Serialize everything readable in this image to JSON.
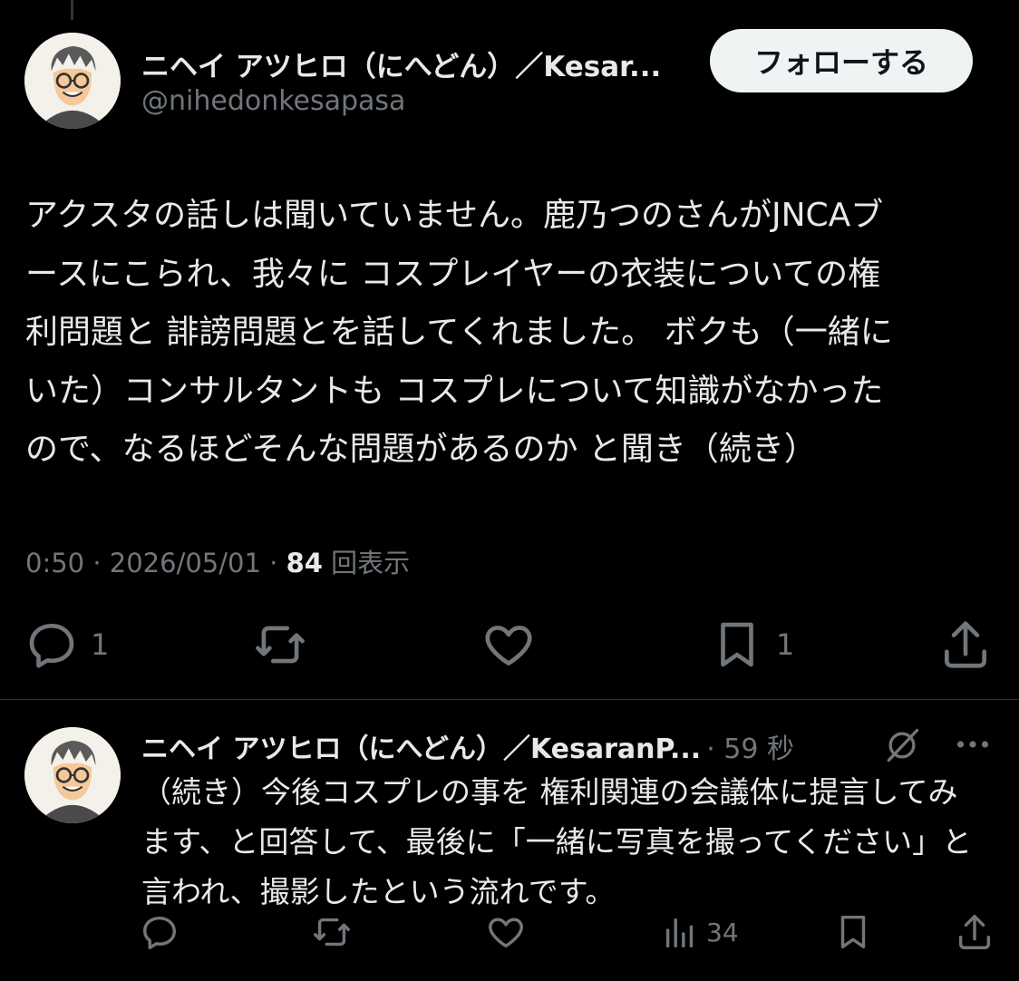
{
  "tweet": {
    "display_name": "ニヘイ アツヒロ（にへどん）／Kesar...",
    "handle": "@nihedonkesapasa",
    "follow_label": "フォローする",
    "text_lines": [
      "アクスタの話しは聞いていません。鹿乃つのさんがJNCAブ",
      "ースにこられ、我々に コスプレイヤーの衣装についての権",
      "利問題と 誹謗問題とを話してくれました。 ボクも（一緒に",
      "いた）コンサルタントも コスプレについて知識がなかった",
      "ので、なるほどそんな問題があるのか と聞き（続き）"
    ],
    "time": "0:50",
    "date": "2026/05/01",
    "views_count": "84",
    "views_label": "回表示",
    "sep": "·",
    "actions": {
      "reply_count": "1",
      "retweet_count": "",
      "like_count": "",
      "bookmark_count": "1"
    }
  },
  "reply": {
    "display_name": "ニヘイ アツヒロ（にへどん）／KesaranP...",
    "time": "· 59 秒",
    "text_lines": [
      "（続き）今後コスプレの事を 権利関連の会議体に提言してみ",
      "ます、と回答して、最後に「一緒に写真を撮ってください」と",
      "言われ、撮影したという流れです。"
    ],
    "actions": {
      "views_count": "34"
    }
  },
  "colors": {
    "background": "#000000",
    "text": "#e7e9ea",
    "muted": "#71767b",
    "follow_bg": "#eff3f4"
  }
}
